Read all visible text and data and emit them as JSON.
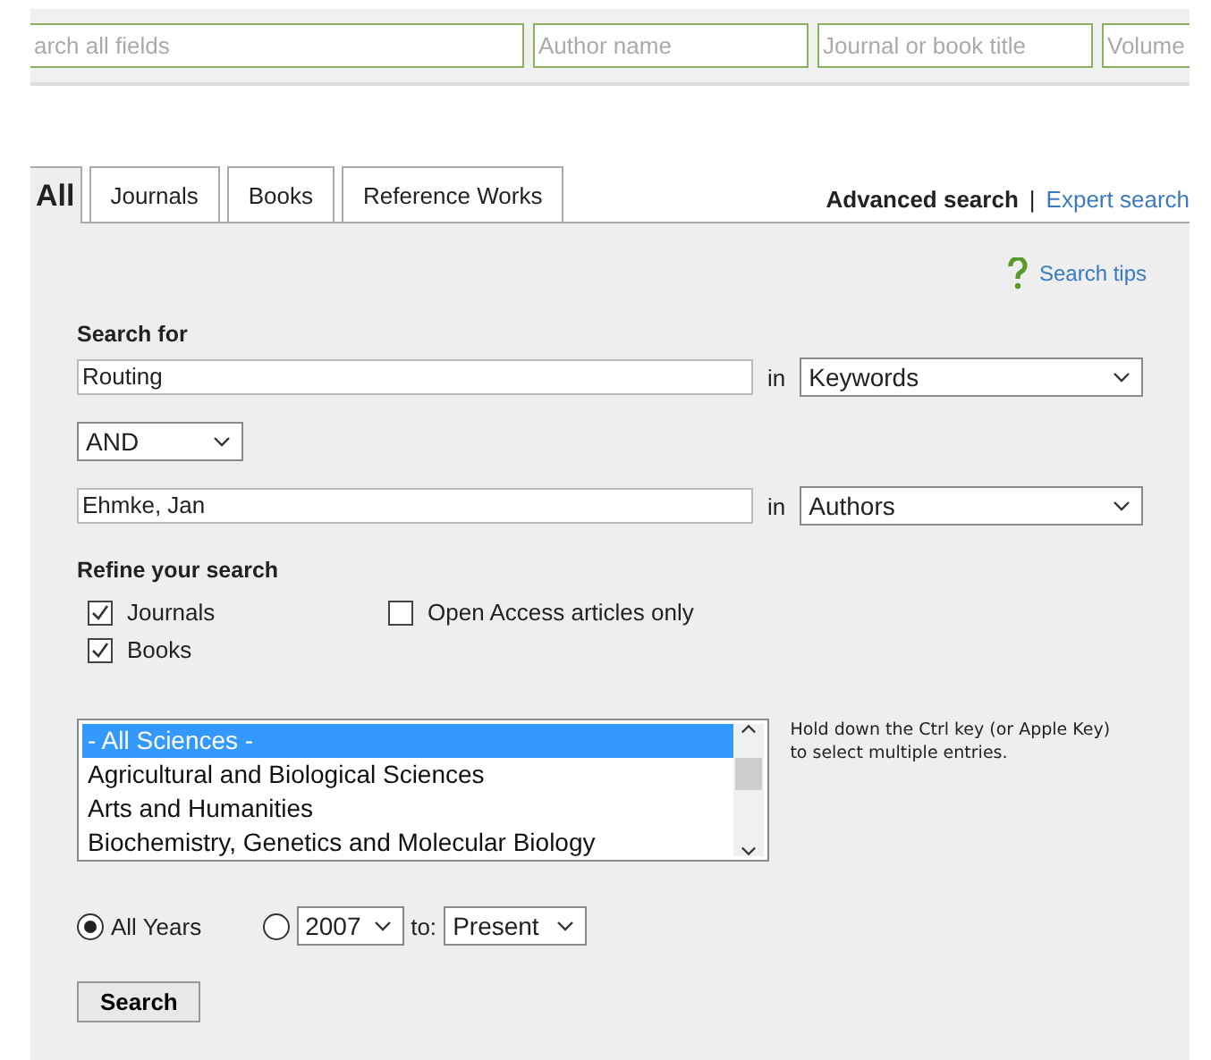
{
  "quick_search": [
    {
      "placeholder": "arch all fields"
    },
    {
      "placeholder": "Author name"
    },
    {
      "placeholder": "Journal or book title"
    },
    {
      "placeholder": "Volume"
    }
  ],
  "tabs": [
    {
      "label": "All",
      "selected": true
    },
    {
      "label": "Journals",
      "selected": false
    },
    {
      "label": "Books",
      "selected": false
    },
    {
      "label": "Reference Works",
      "selected": false
    }
  ],
  "modes": [
    {
      "label": "Advanced search",
      "selected": true
    },
    {
      "label": "Expert search",
      "selected": false
    }
  ],
  "separator": "|",
  "search_tips": "Search tips",
  "search_for": {
    "heading": "Search for",
    "terms": [
      {
        "value": "Routing",
        "in": "in",
        "field": "Keywords"
      },
      {
        "value": "Ehmke, Jan",
        "in": "in",
        "field": "Authors"
      }
    ],
    "operator": "AND"
  },
  "refine": {
    "heading": "Refine your search",
    "options": [
      {
        "label": "Journals",
        "checked": true
      },
      {
        "label": "Books",
        "checked": true
      },
      {
        "label": "Open Access articles only",
        "checked": false
      }
    ]
  },
  "subjects": {
    "items": [
      {
        "label": "- All Sciences -",
        "selected": true
      },
      {
        "label": "Agricultural and Biological Sciences",
        "selected": false
      },
      {
        "label": "Arts and Humanities",
        "selected": false
      },
      {
        "label": "Biochemistry, Genetics and Molecular Biology",
        "selected": false
      }
    ],
    "hint_lines": [
      "Hold down the Ctrl key (or Apple Key)",
      "to select multiple entries."
    ]
  },
  "years": {
    "all_years": {
      "label": "All Years",
      "selected": true
    },
    "range": {
      "selected": false,
      "from": "2007",
      "to_label": "to:",
      "to": "Present"
    }
  },
  "search_button": "Search"
}
